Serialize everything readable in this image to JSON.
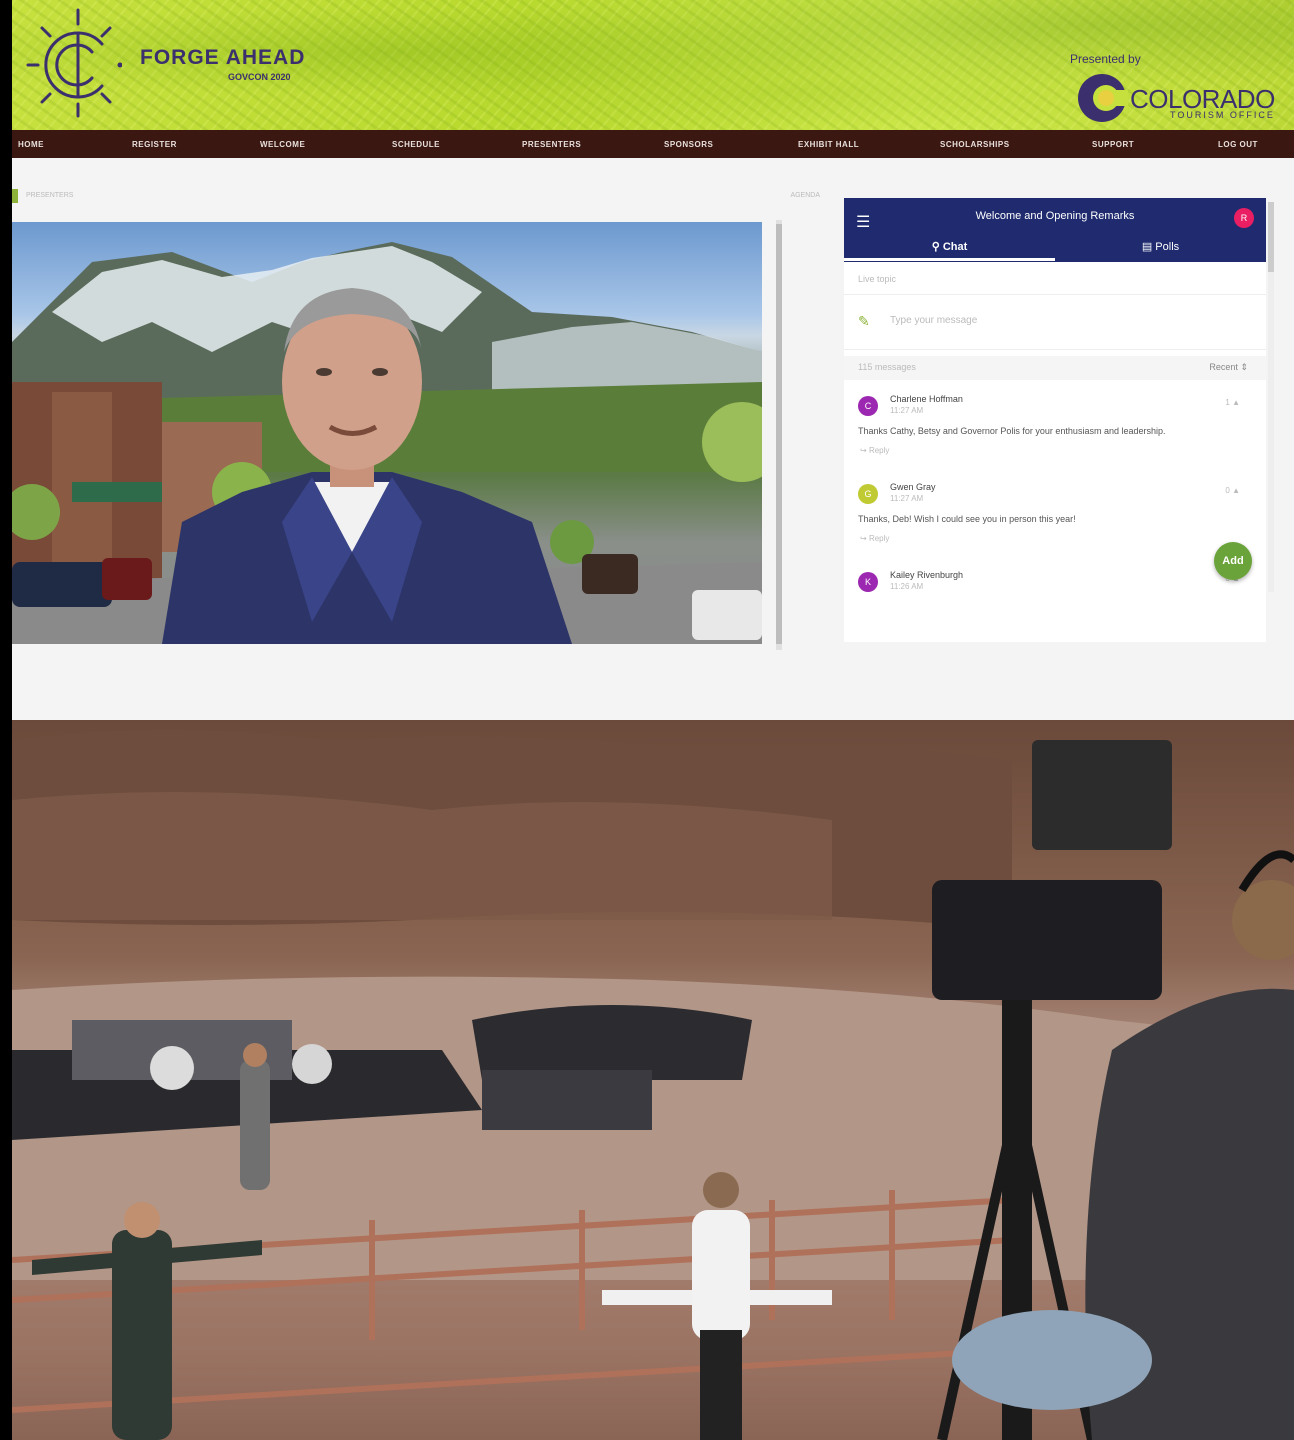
{
  "banner": {
    "title": "FORGE AHEAD",
    "subtitle": "GOVCON 2020",
    "presented_by": "Presented by",
    "sponsor_name": "COLORADO",
    "sponsor_sub": "TOURISM OFFICE"
  },
  "nav": {
    "items": [
      "HOME",
      "REGISTER",
      "WELCOME",
      "SCHEDULE",
      "PRESENTERS",
      "SPONSORS",
      "EXHIBIT HALL",
      "SCHOLARSHIPS",
      "SUPPORT",
      "LOG OUT"
    ]
  },
  "content": {
    "breadcrumb_left": "PRESENTERS",
    "breadcrumb_right": "AGENDA"
  },
  "chat": {
    "title": "Welcome and Opening Remarks",
    "user_initial": "R",
    "tabs": [
      "Chat",
      "Polls"
    ],
    "live_topic": "Live topic",
    "message_placeholder": "Type your message",
    "message_count": "115 messages",
    "sort_label": "Recent",
    "add_label": "Add",
    "messages": [
      {
        "initial": "C",
        "name": "Charlene Hoffman",
        "time": "11:27 AM",
        "text": "Thanks Cathy, Betsy and Governor Polis for your enthusiasm and leadership.",
        "reply": "Reply",
        "likes": "1"
      },
      {
        "initial": "G",
        "name": "Gwen Gray",
        "time": "11:27 AM",
        "text": "Thanks, Deb! Wish I could see you in person this year!",
        "reply": "Reply",
        "likes": "0"
      },
      {
        "initial": "K",
        "name": "Kailey Rivenburgh",
        "time": "11:26 AM",
        "text": "",
        "reply": "",
        "likes": "0"
      }
    ]
  },
  "colors": {
    "nav_bg": "#3b1712",
    "chat_header": "#1f2b6e",
    "accent_green": "#6aa33a",
    "brand_purple": "#3c2f6e",
    "avatar_c": "#9c27b0",
    "avatar_g": "#c0ca33",
    "avatar_k": "#9c27b0",
    "avatar_r": "#e91e63"
  },
  "icons": [
    "compass-logo-icon",
    "colorado-c-icon",
    "hamburger-icon",
    "chat-bubble-icon",
    "bar-chart-icon",
    "edit-icon",
    "thumbs-up-icon",
    "reply-icon",
    "sort-icon"
  ]
}
